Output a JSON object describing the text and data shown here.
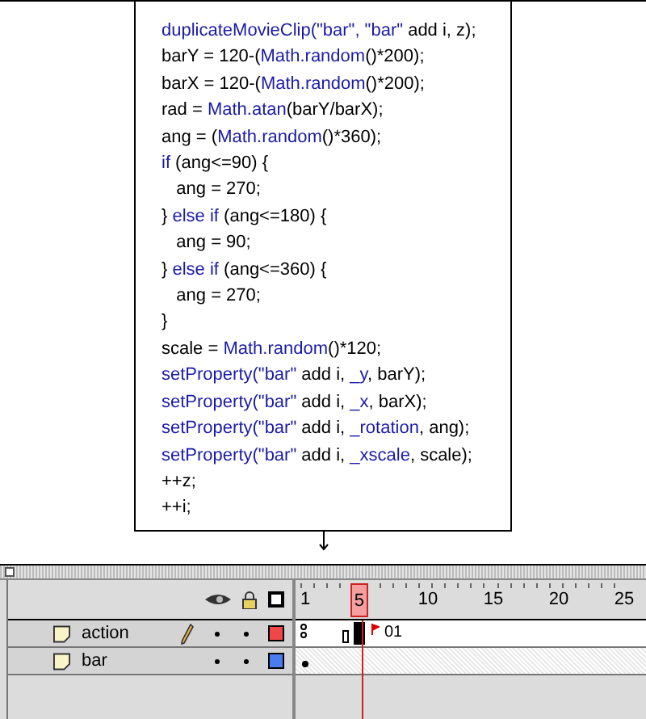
{
  "code": {
    "lines": [
      {
        "parts": [
          {
            "text": "duplicateMovieClip(\"bar\", \"bar\"",
            "kind": "keyword"
          },
          {
            "text": " add i, z);",
            "kind": "plain"
          }
        ]
      },
      {
        "parts": [
          {
            "text": "barY = 120-(",
            "kind": "plain"
          },
          {
            "text": "Math.random",
            "kind": "keyword"
          },
          {
            "text": "()*200);",
            "kind": "plain"
          }
        ]
      },
      {
        "parts": [
          {
            "text": "barX = 120-(",
            "kind": "plain"
          },
          {
            "text": "Math.random",
            "kind": "keyword"
          },
          {
            "text": "()*200);",
            "kind": "plain"
          }
        ]
      },
      {
        "parts": [
          {
            "text": "rad = ",
            "kind": "plain"
          },
          {
            "text": "Math.atan",
            "kind": "keyword"
          },
          {
            "text": "(barY/barX);",
            "kind": "plain"
          }
        ]
      },
      {
        "parts": [
          {
            "text": "ang = (",
            "kind": "plain"
          },
          {
            "text": "Math.random",
            "kind": "keyword"
          },
          {
            "text": "()*360);",
            "kind": "plain"
          }
        ]
      },
      {
        "parts": [
          {
            "text": "if",
            "kind": "keyword"
          },
          {
            "text": " (ang<=90) {",
            "kind": "plain"
          }
        ]
      },
      {
        "parts": [
          {
            "text": "   ang = 270;",
            "kind": "plain"
          }
        ]
      },
      {
        "parts": [
          {
            "text": "} ",
            "kind": "plain"
          },
          {
            "text": "else if",
            "kind": "keyword"
          },
          {
            "text": " (ang<=180) {",
            "kind": "plain"
          }
        ]
      },
      {
        "parts": [
          {
            "text": "   ang = 90;",
            "kind": "plain"
          }
        ]
      },
      {
        "parts": [
          {
            "text": "} ",
            "kind": "plain"
          },
          {
            "text": "else if",
            "kind": "keyword"
          },
          {
            "text": " (ang<=360) {",
            "kind": "plain"
          }
        ]
      },
      {
        "parts": [
          {
            "text": "   ang = 270;",
            "kind": "plain"
          }
        ]
      },
      {
        "parts": [
          {
            "text": "}",
            "kind": "plain"
          }
        ]
      },
      {
        "parts": [
          {
            "text": "scale = ",
            "kind": "plain"
          },
          {
            "text": "Math.random",
            "kind": "keyword"
          },
          {
            "text": "()*120;",
            "kind": "plain"
          }
        ]
      },
      {
        "parts": [
          {
            "text": "setProperty(\"bar\"",
            "kind": "keyword"
          },
          {
            "text": " add i, ",
            "kind": "plain"
          },
          {
            "text": "_y",
            "kind": "keyword"
          },
          {
            "text": ", barY);",
            "kind": "plain"
          }
        ]
      },
      {
        "parts": [
          {
            "text": "setProperty(\"bar\"",
            "kind": "keyword"
          },
          {
            "text": " add i, ",
            "kind": "plain"
          },
          {
            "text": "_x",
            "kind": "keyword"
          },
          {
            "text": ", barX);",
            "kind": "plain"
          }
        ]
      },
      {
        "parts": [
          {
            "text": "setProperty(\"bar\"",
            "kind": "keyword"
          },
          {
            "text": " add i, ",
            "kind": "plain"
          },
          {
            "text": "_rotation",
            "kind": "keyword"
          },
          {
            "text": ", ang);",
            "kind": "plain"
          }
        ]
      },
      {
        "parts": [
          {
            "text": "setProperty(\"bar\"",
            "kind": "keyword"
          },
          {
            "text": " add i, ",
            "kind": "plain"
          },
          {
            "text": "_xscale",
            "kind": "keyword"
          },
          {
            "text": ", scale);",
            "kind": "plain"
          }
        ]
      },
      {
        "parts": [
          {
            "text": "++z;",
            "kind": "plain"
          }
        ]
      },
      {
        "parts": [
          {
            "text": "++i;",
            "kind": "plain"
          }
        ]
      }
    ]
  },
  "timeline": {
    "ruler": [
      {
        "label": "1",
        "selected": false
      },
      {
        "label": "5",
        "selected": true
      },
      {
        "label": "10",
        "selected": false
      },
      {
        "label": "15",
        "selected": false
      },
      {
        "label": "20",
        "selected": false
      },
      {
        "label": "25",
        "selected": false
      }
    ],
    "layers": [
      {
        "name": "action",
        "editing": true,
        "color": "#f04848",
        "frame_label": "01"
      },
      {
        "name": "bar",
        "editing": false,
        "color": "#4a7cf0"
      }
    ]
  }
}
